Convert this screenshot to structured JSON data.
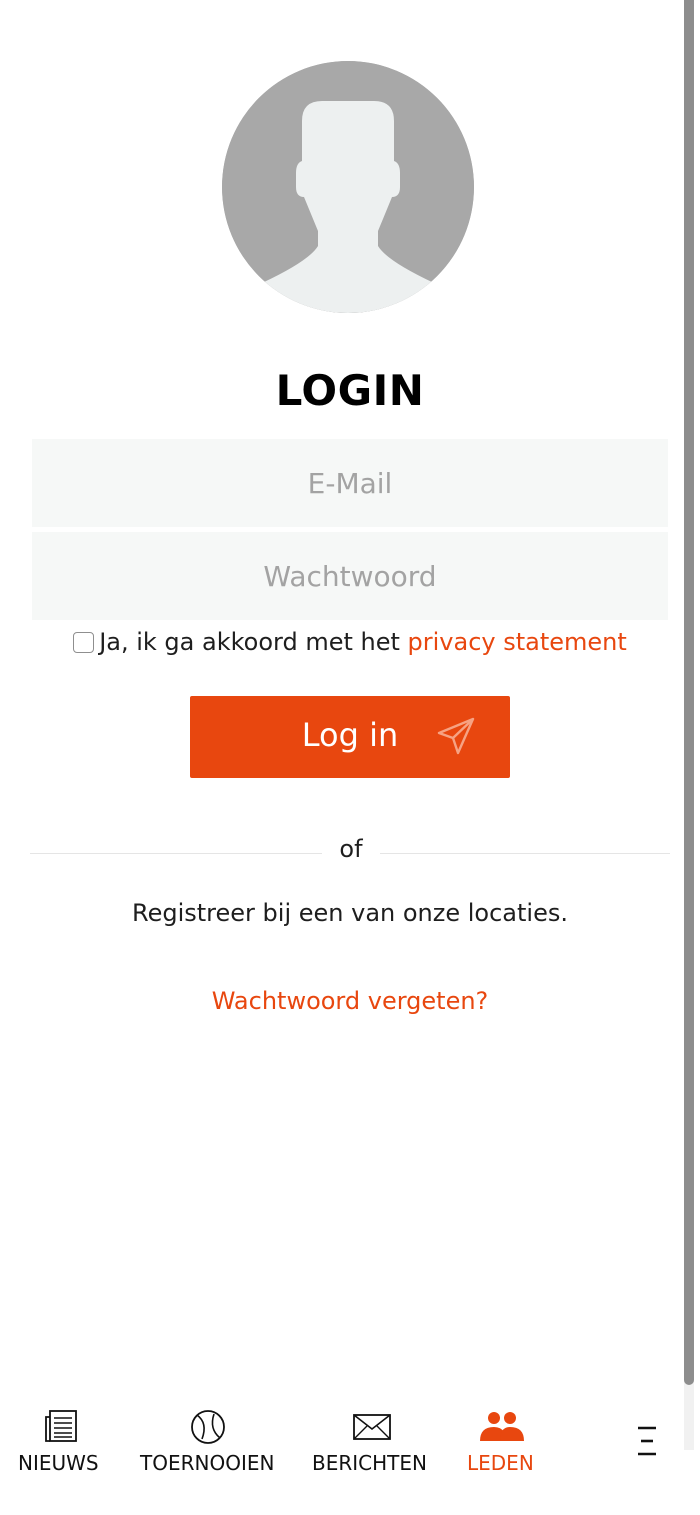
{
  "login": {
    "title": "LOGIN",
    "email_placeholder": "E-Mail",
    "password_placeholder": "Wachtwoord",
    "consent_text": "Ja, ik ga akkoord met het ",
    "privacy_link": "privacy statement",
    "login_button": "Log in",
    "or_text": "of",
    "register_text": "Registreer bij een van onze locaties.",
    "forgot_link": "Wachtwoord vergeten?"
  },
  "nav": {
    "items": [
      {
        "label": "NIEUWS",
        "icon": "newspaper-icon"
      },
      {
        "label": "TOERNOOIEN",
        "icon": "tennis-ball-icon"
      },
      {
        "label": "BERICHTEN",
        "icon": "envelope-icon"
      },
      {
        "label": "LEDEN",
        "icon": "members-icon",
        "active": true
      },
      {
        "label": "",
        "icon": "menu-icon"
      }
    ]
  },
  "colors": {
    "accent": "#e8470f",
    "input_background": "#f6f8f7",
    "avatar_background": "#a8a8a8"
  }
}
